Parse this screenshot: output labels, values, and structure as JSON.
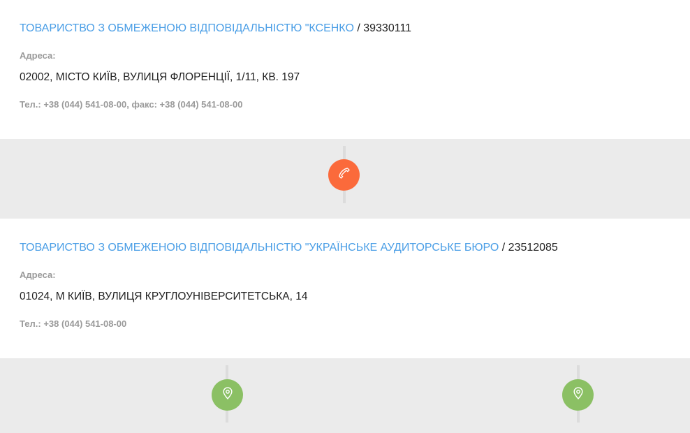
{
  "colors": {
    "link": "#4a9ee6",
    "phone_button": "#fb6a3b",
    "geo_button": "#8bc064",
    "band": "#ebebeb"
  },
  "companies": [
    {
      "name": "ТОВАРИСТВО З ОБМЕЖЕНОЮ ВІДПОВІДАЛЬНІСТЮ \"КСЕНКО",
      "separator": " / ",
      "code": "39330111",
      "address_label": "Адреса:",
      "address": "02002, МІСТО КИЇВ, ВУЛИЦЯ ФЛОРЕНЦІЇ, 1/11, КВ. 197",
      "phones": "Тел.: +38 (044) 541-08-00, факс: +38 (044) 541-08-00"
    },
    {
      "name": "ТОВАРИСТВО З ОБМЕЖЕНОЮ ВІДПОВІДАЛЬНІСТЮ \"УКРАЇНСЬКЕ АУДИТОРСЬКЕ БЮРО",
      "separator": " / ",
      "code": "23512085",
      "address_label": "Адреса:",
      "address": "01024, М КИЇВ, ВУЛИЦЯ КРУГЛОУНІВЕРСИТЕТСЬКА, 14",
      "phones": "Тел.: +38 (044) 541-08-00"
    }
  ],
  "connectors": [
    {
      "icon": "phone-icon"
    },
    {
      "icons": [
        "map-pin-icon",
        "map-pin-icon"
      ]
    }
  ]
}
